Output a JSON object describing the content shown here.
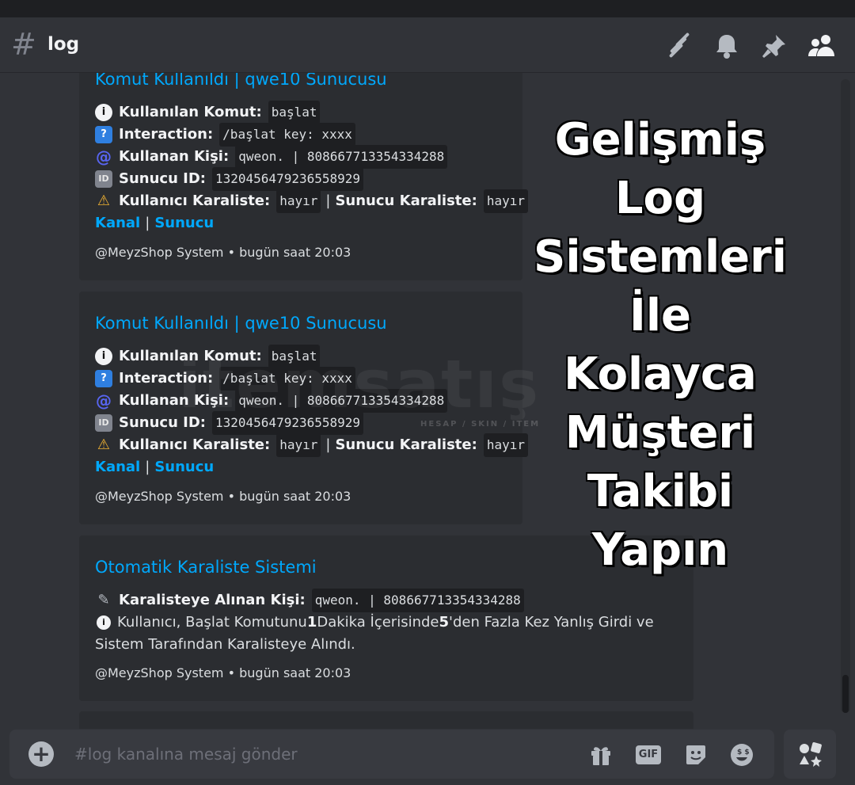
{
  "header": {
    "channel_hash": "#",
    "channel_name": "log"
  },
  "embeds": [
    {
      "title": "Komut Kullanıldı | qwe10 Sunucusu",
      "command_label": "Kullanılan Komut:",
      "command_value": "başlat",
      "interaction_label": "Interaction:",
      "interaction_value": "/başlat key: xxxx",
      "user_label": "Kullanan Kişi:",
      "user_value": "qweon. | 808667713354334288",
      "server_label": "Sunucu ID:",
      "server_value": "1320456479236558929",
      "user_bl_label": "Kullanıcı Karaliste:",
      "user_bl_value": "hayır",
      "server_bl_label": "Sunucu Karaliste:",
      "server_bl_value": "hayır",
      "link_channel": "Kanal",
      "link_server": "Sunucu",
      "footer_author": "@MeyzShop System",
      "footer_time": "bugün saat 20:03"
    },
    {
      "title": "Komut Kullanıldı | qwe10 Sunucusu",
      "command_label": "Kullanılan Komut:",
      "command_value": "başlat",
      "interaction_label": "Interaction:",
      "interaction_value": "/başlat key: xxxx",
      "user_label": "Kullanan Kişi:",
      "user_value": "qweon. | 808667713354334288",
      "server_label": "Sunucu ID:",
      "server_value": "1320456479236558929",
      "user_bl_label": "Kullanıcı Karaliste:",
      "user_bl_value": "hayır",
      "server_bl_label": "Sunucu Karaliste:",
      "server_bl_value": "hayır",
      "link_channel": "Kanal",
      "link_server": "Sunucu",
      "footer_author": "@MeyzShop System",
      "footer_time": "bugün saat 20:03"
    }
  ],
  "blacklist_embed": {
    "title": "Otomatik Karaliste Sistemi",
    "person_label": "Karalisteye Alınan Kişi:",
    "person_value": "qweon. | 808667713354334288",
    "desc_1": "Kullanıcı, Başlat Komutunu ",
    "desc_num1": "1",
    "desc_2": " Dakika İçerisinde ",
    "desc_num2": "5",
    "desc_3": "'den Fazla Kez Yanlış Girdi ve",
    "desc_line2": "Sistem Tarafından Karalisteye Alındı.",
    "footer_author": "@MeyzShop System",
    "footer_time": "bugün saat 20:03"
  },
  "overlay_lines": [
    "Gelişmiş",
    "Log",
    "Sistemleri",
    "İle Kolayca",
    "Müşteri",
    "Takibi",
    "Yapın"
  ],
  "watermark": {
    "text": "itemsatış",
    "subtext": "HESAP / SKIN / ITEM"
  },
  "composer": {
    "placeholder": "#log kanalına mesaj gönder",
    "gif_label": "GIF"
  },
  "icons": [
    "threads-icon",
    "bell-icon",
    "pin-icon",
    "members-icon",
    "plus-icon",
    "gift-icon",
    "gif-icon",
    "sticker-icon",
    "emoji-icon",
    "apps-icon"
  ],
  "colors": {
    "link": "#00a8fc",
    "bg": "#313338",
    "embed_bg": "#2b2d31",
    "composer_bg": "#383a40"
  }
}
